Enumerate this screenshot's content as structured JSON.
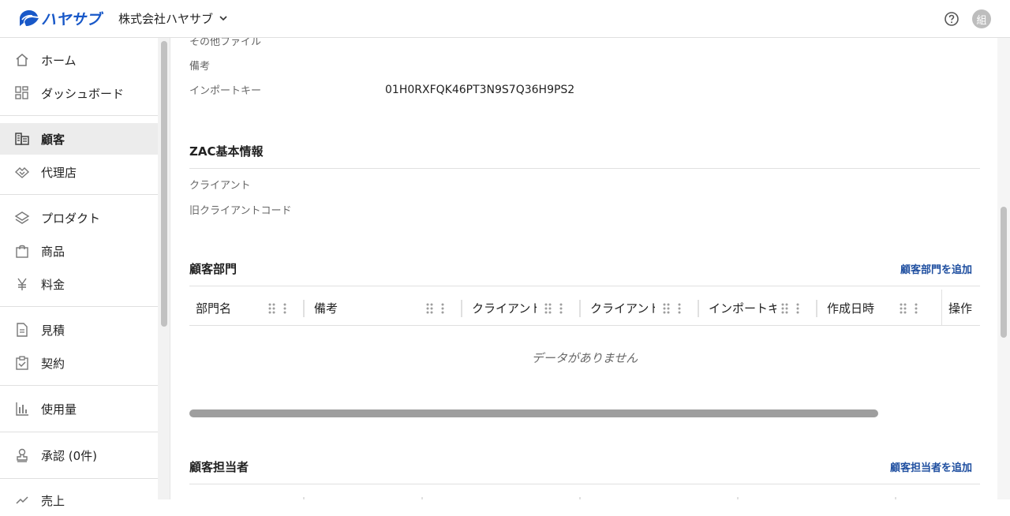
{
  "header": {
    "logo_text": "ハヤサブ",
    "company_name": "株式会社ハヤサブ",
    "avatar_text": "組"
  },
  "sidebar": {
    "items": [
      {
        "label": "ホーム",
        "icon": "home-icon"
      },
      {
        "label": "ダッシュボード",
        "icon": "dashboard-icon"
      },
      {
        "label": "顧客",
        "icon": "customer-icon",
        "active": true
      },
      {
        "label": "代理店",
        "icon": "agency-icon"
      },
      {
        "label": "プロダクト",
        "icon": "layers-icon"
      },
      {
        "label": "商品",
        "icon": "bag-icon"
      },
      {
        "label": "料金",
        "icon": "yen-icon"
      },
      {
        "label": "見積",
        "icon": "document-icon"
      },
      {
        "label": "契約",
        "icon": "clipboard-check-icon"
      },
      {
        "label": "使用量",
        "icon": "bar-chart-icon"
      },
      {
        "label": "承認 (0件)",
        "icon": "stamp-icon"
      },
      {
        "label": "売上",
        "icon": "sales-icon"
      }
    ]
  },
  "detail": {
    "fields_top": [
      {
        "label": "その他ファイル",
        "value": ""
      },
      {
        "label": "備考",
        "value": ""
      },
      {
        "label": "インポートキー",
        "value": "01H0RXFQK46PT3N9S7Q36H9PS2"
      }
    ],
    "zac_section": {
      "title": "ZAC基本情報",
      "fields": [
        {
          "label": "クライアント",
          "value": ""
        },
        {
          "label": "旧クライアントコード",
          "value": ""
        }
      ]
    },
    "departments": {
      "title": "顧客部門",
      "add_label": "顧客部門を追加",
      "columns": [
        "部門名",
        "備考",
        "クライアント",
        "クライアント",
        "インポートキー",
        "作成日時",
        "操作"
      ],
      "empty_text": "データがありません"
    },
    "contacts": {
      "title": "顧客担当者",
      "add_label": "顧客担当者を追加"
    }
  },
  "colors": {
    "brand": "#1858c8",
    "link": "#1f4fa0",
    "active_bg": "#ececec"
  }
}
